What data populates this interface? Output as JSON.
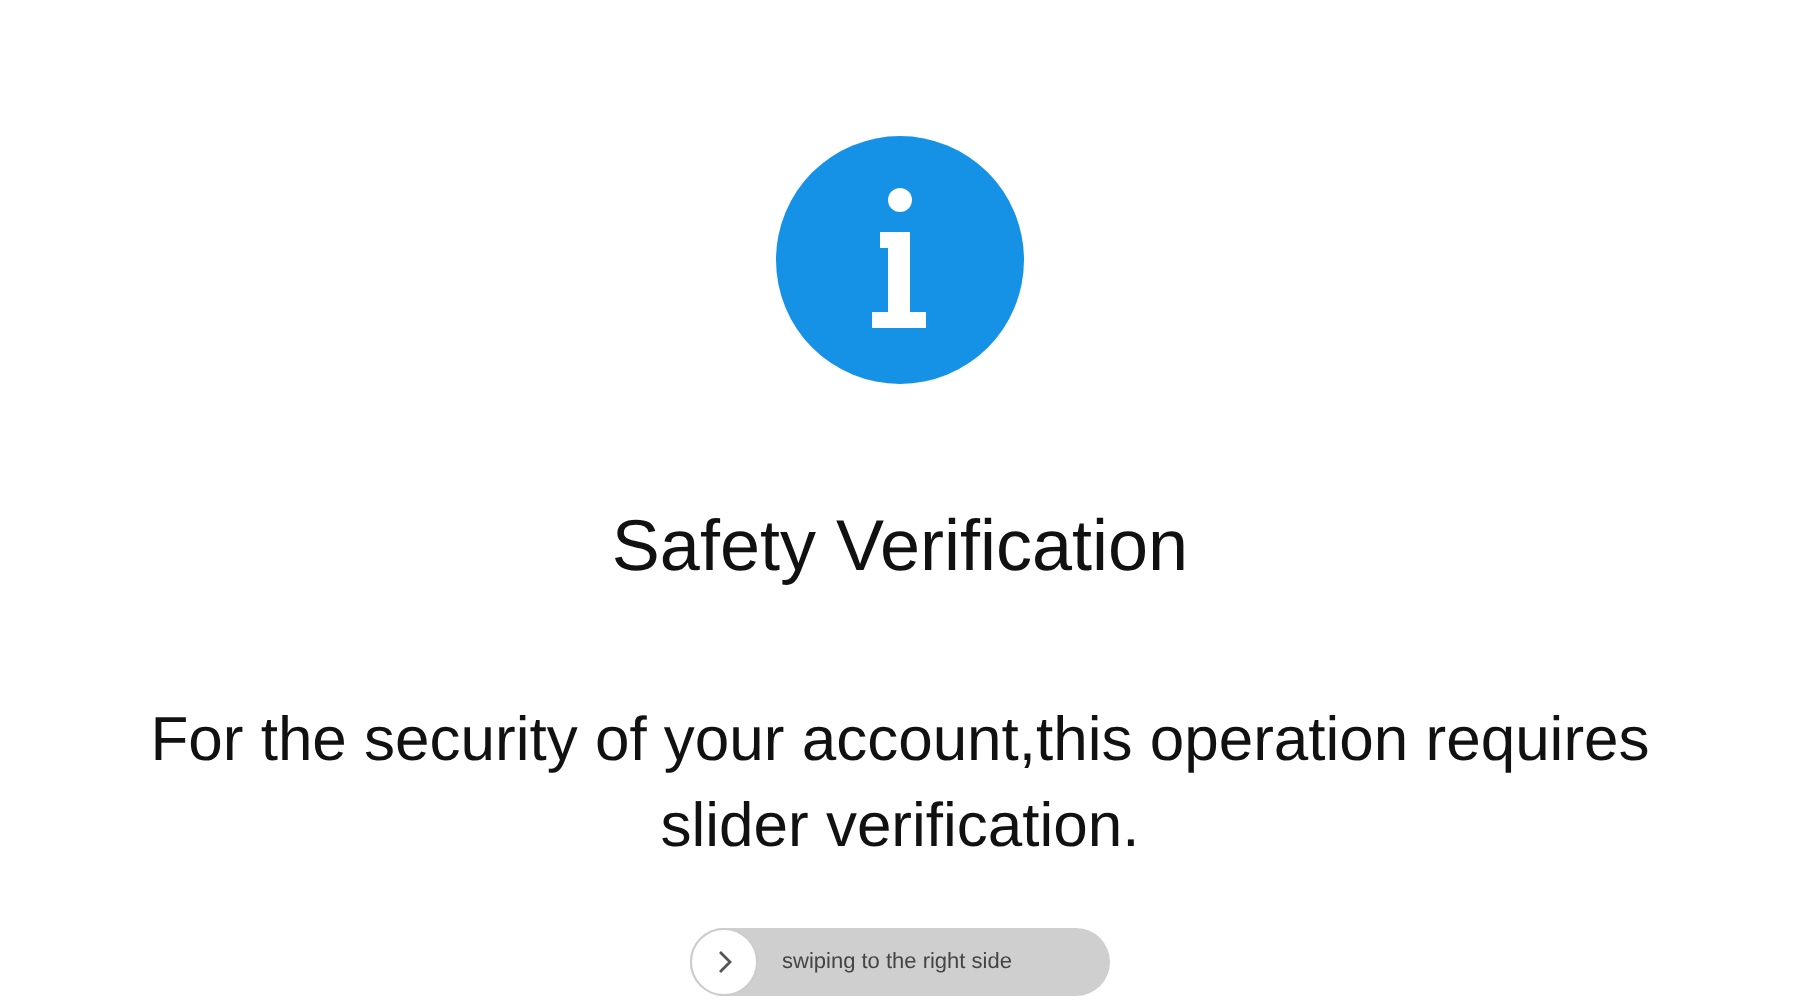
{
  "title": "Safety Verification",
  "message": "For the security of your account,this operation requires slider verification.",
  "slider": {
    "label": "swiping to the right side",
    "level": 0
  }
}
